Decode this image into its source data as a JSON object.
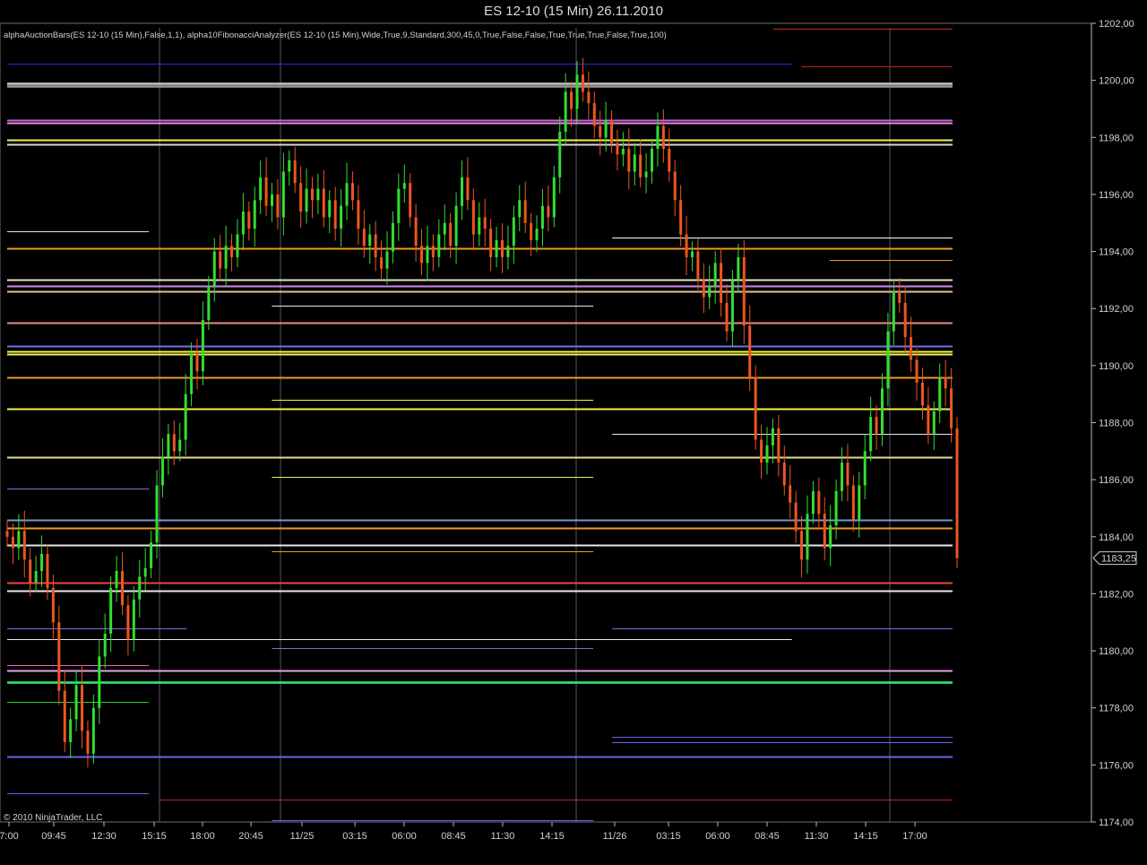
{
  "window": {
    "title": "ES 12-10 (15 Min)  26.11.2010"
  },
  "indicator_label": "alphaAuctionBars(ES 12-10 (15 Min),False,1,1), alpha10FibonacciAnalyzer(ES 12-10 (15 Min),Wide,True,9,Standard,300,45,0,True,False,False,True,True,True,False,True,100)",
  "copyright": "© 2010 NinjaTrader, LLC",
  "colors": {
    "up_bar": "#33dd33",
    "down_bar": "#ee5522",
    "background": "#000000",
    "grid": "#5a5a70"
  },
  "chart_data": {
    "type": "candlestick",
    "title": "ES 12-10 (15 Min)  26.11.2010",
    "ylim": [
      1174,
      1202
    ],
    "y_ticks": [
      "1174,00",
      "1176,00",
      "1178,00",
      "1180,00",
      "1182,00",
      "1184,00",
      "1186,00",
      "1188,00",
      "1190,00",
      "1192,00",
      "1194,00",
      "1196,00",
      "1198,00",
      "1200,00",
      "1202,00"
    ],
    "x_tick_labels": [
      "7:00",
      "09:45",
      "12:30",
      "15:15",
      "18:00",
      "20:45",
      "11/25",
      "03:15",
      "06:00",
      "08:45",
      "11:30",
      "14:15",
      "11/26",
      "03:15",
      "06:00",
      "08:45",
      "11:30",
      "14:15",
      "17:00"
    ],
    "last_price_label": "1183,25",
    "last_price": 1183.25,
    "session_breaks": [
      3,
      6,
      12,
      18
    ],
    "series_closes": [
      1184.0,
      1183.6,
      1184.2,
      1183.2,
      1182.4,
      1182.8,
      1183.4,
      1182.2,
      1181.0,
      1178.6,
      1176.8,
      1177.6,
      1178.8,
      1177.2,
      1176.4,
      1178.0,
      1179.8,
      1180.6,
      1182.2,
      1182.8,
      1181.6,
      1180.4,
      1181.8,
      1182.6,
      1182.9,
      1183.8,
      1185.8,
      1186.8,
      1187.6,
      1187.0,
      1187.4,
      1189.0,
      1190.4,
      1189.8,
      1191.6,
      1192.8,
      1194.0,
      1193.4,
      1194.2,
      1193.8,
      1194.6,
      1195.4,
      1194.8,
      1195.8,
      1196.6,
      1195.6,
      1196.0,
      1195.2,
      1196.8,
      1197.2,
      1196.4,
      1195.4,
      1196.2,
      1195.8,
      1196.2,
      1195.2,
      1195.8,
      1194.8,
      1195.6,
      1196.4,
      1195.8,
      1194.8,
      1194.2,
      1194.6,
      1193.8,
      1193.4,
      1194.0,
      1195.0,
      1196.2,
      1196.4,
      1195.2,
      1194.2,
      1193.6,
      1194.2,
      1193.8,
      1194.6,
      1195.0,
      1194.2,
      1195.6,
      1196.6,
      1195.8,
      1194.6,
      1195.2,
      1194.8,
      1193.8,
      1194.4,
      1193.8,
      1194.2,
      1195.2,
      1195.8,
      1195.0,
      1194.4,
      1194.8,
      1195.6,
      1195.2,
      1196.6,
      1198.2,
      1199.6,
      1199.0,
      1200.2,
      1199.6,
      1199.2,
      1198.4,
      1198.0,
      1198.6,
      1197.8,
      1197.4,
      1197.6,
      1196.8,
      1197.4,
      1196.6,
      1196.8,
      1197.6,
      1198.4,
      1197.6,
      1196.8,
      1195.8,
      1194.6,
      1193.8,
      1194.0,
      1193.0,
      1192.4,
      1192.8,
      1193.6,
      1192.2,
      1191.2,
      1193.0,
      1193.8,
      1191.4,
      1189.6,
      1187.4,
      1186.6,
      1187.2,
      1187.8,
      1186.6,
      1185.8,
      1185.2,
      1184.2,
      1183.2,
      1184.8,
      1185.6,
      1184.8,
      1183.6,
      1184.4,
      1185.6,
      1186.6,
      1185.8,
      1184.6,
      1185.8,
      1187.0,
      1188.2,
      1187.6,
      1189.2,
      1191.2,
      1192.6,
      1192.2,
      1191.0,
      1190.2,
      1189.4,
      1188.6,
      1187.6,
      1188.4,
      1189.6,
      1189.2,
      1187.8,
      1183.25
    ],
    "levels": [
      {
        "price": 1201.8,
        "color": "#cc2222",
        "x0": 0.81,
        "x1": 1.0
      },
      {
        "price": 1200.6,
        "color": "#2a2ad8",
        "x0": 0.0,
        "x1": 0.83
      },
      {
        "price": 1200.5,
        "color": "#cc2222",
        "x0": 0.84,
        "x1": 1.0
      },
      {
        "price": 1199.9,
        "color": "#c8c8c8",
        "x0": 0.0,
        "x1": 1.0
      },
      {
        "price": 1199.8,
        "color": "#9a9a9a",
        "x0": 0.0,
        "x1": 1.0
      },
      {
        "price": 1198.6,
        "color": "#bb66ee",
        "x0": 0.0,
        "x1": 1.0
      },
      {
        "price": 1198.5,
        "color": "#ee88cc",
        "x0": 0.0,
        "x1": 1.0
      },
      {
        "price": 1197.9,
        "color": "#f2f24a",
        "x0": 0.0,
        "x1": 1.0
      },
      {
        "price": 1197.75,
        "color": "#d8d8d8",
        "x0": 0.0,
        "x1": 1.0
      },
      {
        "price": 1194.7,
        "color": "#e0e0e0",
        "x0": 0.0,
        "x1": 0.15
      },
      {
        "price": 1194.5,
        "color": "#ffffff",
        "x0": 0.64,
        "x1": 1.0
      },
      {
        "price": 1194.1,
        "color": "#ee9a22",
        "x0": 0.0,
        "x1": 1.0
      },
      {
        "price": 1193.7,
        "color": "#ee9a22",
        "x0": 0.87,
        "x1": 1.0
      },
      {
        "price": 1193.0,
        "color": "#e8e0c0",
        "x0": 0.0,
        "x1": 1.0
      },
      {
        "price": 1192.8,
        "color": "#cc88ee",
        "x0": 0.0,
        "x1": 1.0
      },
      {
        "price": 1192.6,
        "color": "#e8c088",
        "x0": 0.0,
        "x1": 1.0
      },
      {
        "price": 1192.1,
        "color": "#e8e8e8",
        "x0": 0.28,
        "x1": 0.62
      },
      {
        "price": 1191.5,
        "color": "#ee8888",
        "x0": 0.0,
        "x1": 1.0
      },
      {
        "price": 1190.7,
        "color": "#7070ee",
        "x0": 0.0,
        "x1": 1.0
      },
      {
        "price": 1190.5,
        "color": "#f2f24a",
        "x0": 0.0,
        "x1": 1.0
      },
      {
        "price": 1190.4,
        "color": "#f2f24a",
        "x0": 0.0,
        "x1": 1.0
      },
      {
        "price": 1189.6,
        "color": "#ee9a22",
        "x0": 0.0,
        "x1": 1.0
      },
      {
        "price": 1188.8,
        "color": "#f2f24a",
        "x0": 0.28,
        "x1": 0.62
      },
      {
        "price": 1188.5,
        "color": "#f2f24a",
        "x0": 0.0,
        "x1": 1.0
      },
      {
        "price": 1187.6,
        "color": "#e8e8e8",
        "x0": 0.64,
        "x1": 1.0
      },
      {
        "price": 1186.8,
        "color": "#e8d890",
        "x0": 0.0,
        "x1": 1.0
      },
      {
        "price": 1186.1,
        "color": "#f2f24a",
        "x0": 0.28,
        "x1": 0.62
      },
      {
        "price": 1185.7,
        "color": "#9966dd",
        "x0": 0.0,
        "x1": 0.15
      },
      {
        "price": 1184.6,
        "color": "#7799cc",
        "x0": 0.0,
        "x1": 1.0
      },
      {
        "price": 1184.3,
        "color": "#ee9a22",
        "x0": 0.0,
        "x1": 1.0
      },
      {
        "price": 1183.7,
        "color": "#e8e8e8",
        "x0": 0.0,
        "x1": 1.0
      },
      {
        "price": 1183.5,
        "color": "#ee9a22",
        "x0": 0.28,
        "x1": 0.62
      },
      {
        "price": 1182.4,
        "color": "#ee4444",
        "x0": 0.0,
        "x1": 1.0
      },
      {
        "price": 1182.1,
        "color": "#e8e8e8",
        "x0": 0.0,
        "x1": 1.0
      },
      {
        "price": 1180.8,
        "color": "#8866dd",
        "x0": 0.0,
        "x1": 0.19
      },
      {
        "price": 1180.8,
        "color": "#8866dd",
        "x0": 0.64,
        "x1": 1.0
      },
      {
        "price": 1180.4,
        "color": "#e8e8e8",
        "x0": 0.0,
        "x1": 0.83
      },
      {
        "price": 1180.1,
        "color": "#8866dd",
        "x0": 0.28,
        "x1": 0.62
      },
      {
        "price": 1179.5,
        "color": "#ee66aa",
        "x0": 0.0,
        "x1": 0.15
      },
      {
        "price": 1179.3,
        "color": "#e8a0e8",
        "x0": 0.0,
        "x1": 1.0
      },
      {
        "price": 1178.9,
        "color": "#33ee77",
        "x0": 0.0,
        "x1": 1.0
      },
      {
        "price": 1178.2,
        "color": "#33cc33",
        "x0": 0.0,
        "x1": 0.15
      },
      {
        "price": 1177.0,
        "color": "#6666ee",
        "x0": 0.64,
        "x1": 1.0
      },
      {
        "price": 1176.8,
        "color": "#6666ee",
        "x0": 0.64,
        "x1": 1.0
      },
      {
        "price": 1176.3,
        "color": "#6666ee",
        "x0": 0.0,
        "x1": 1.0
      },
      {
        "price": 1175.0,
        "color": "#6666ee",
        "x0": 0.0,
        "x1": 0.15
      },
      {
        "price": 1174.8,
        "color": "#cc2222",
        "x0": 0.16,
        "x1": 1.0
      },
      {
        "price": 1174.05,
        "color": "#6666ee",
        "x0": 0.28,
        "x1": 0.62
      }
    ]
  }
}
